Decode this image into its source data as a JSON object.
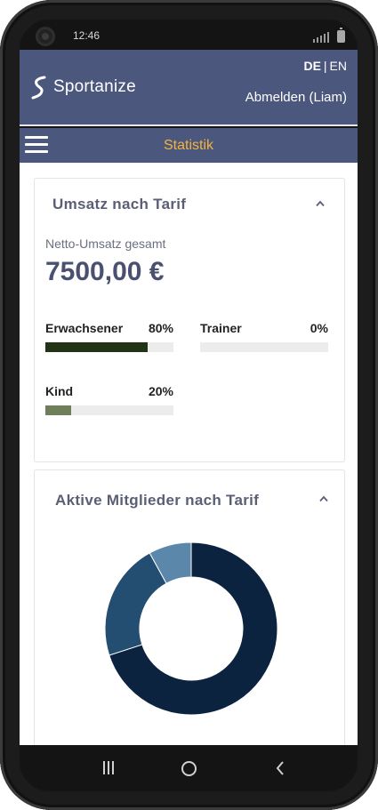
{
  "status_bar": {
    "time": "12:46"
  },
  "header": {
    "logo_text": "Sportanize",
    "lang_active": "DE",
    "lang_separator": "|",
    "lang_other": "EN",
    "logout_label": "Abmelden (Liam)"
  },
  "nav": {
    "title": "Statistik"
  },
  "revenue_card": {
    "title": "Umsatz nach Tarif",
    "net_label": "Netto-Umsatz gesamt",
    "net_value": "7500,00 €",
    "tariffs": [
      {
        "name": "Erwachsener",
        "percent_label": "80%",
        "percent": 80,
        "color": "#223316"
      },
      {
        "name": "Trainer",
        "percent_label": "0%",
        "percent": 0,
        "color": "#223316"
      },
      {
        "name": "Kind",
        "percent_label": "20%",
        "percent": 20,
        "color": "#6f7f5c"
      }
    ]
  },
  "members_card": {
    "title": "Aktive Mitglieder nach Tarif"
  },
  "chart_data": {
    "type": "pie",
    "variant": "donut",
    "values": [
      70,
      22,
      8
    ],
    "colors": [
      "#0c2340",
      "#234e72",
      "#5b87aa"
    ]
  },
  "colors": {
    "header_bg": "#4c577e",
    "nav_title": "#f2b43b"
  }
}
